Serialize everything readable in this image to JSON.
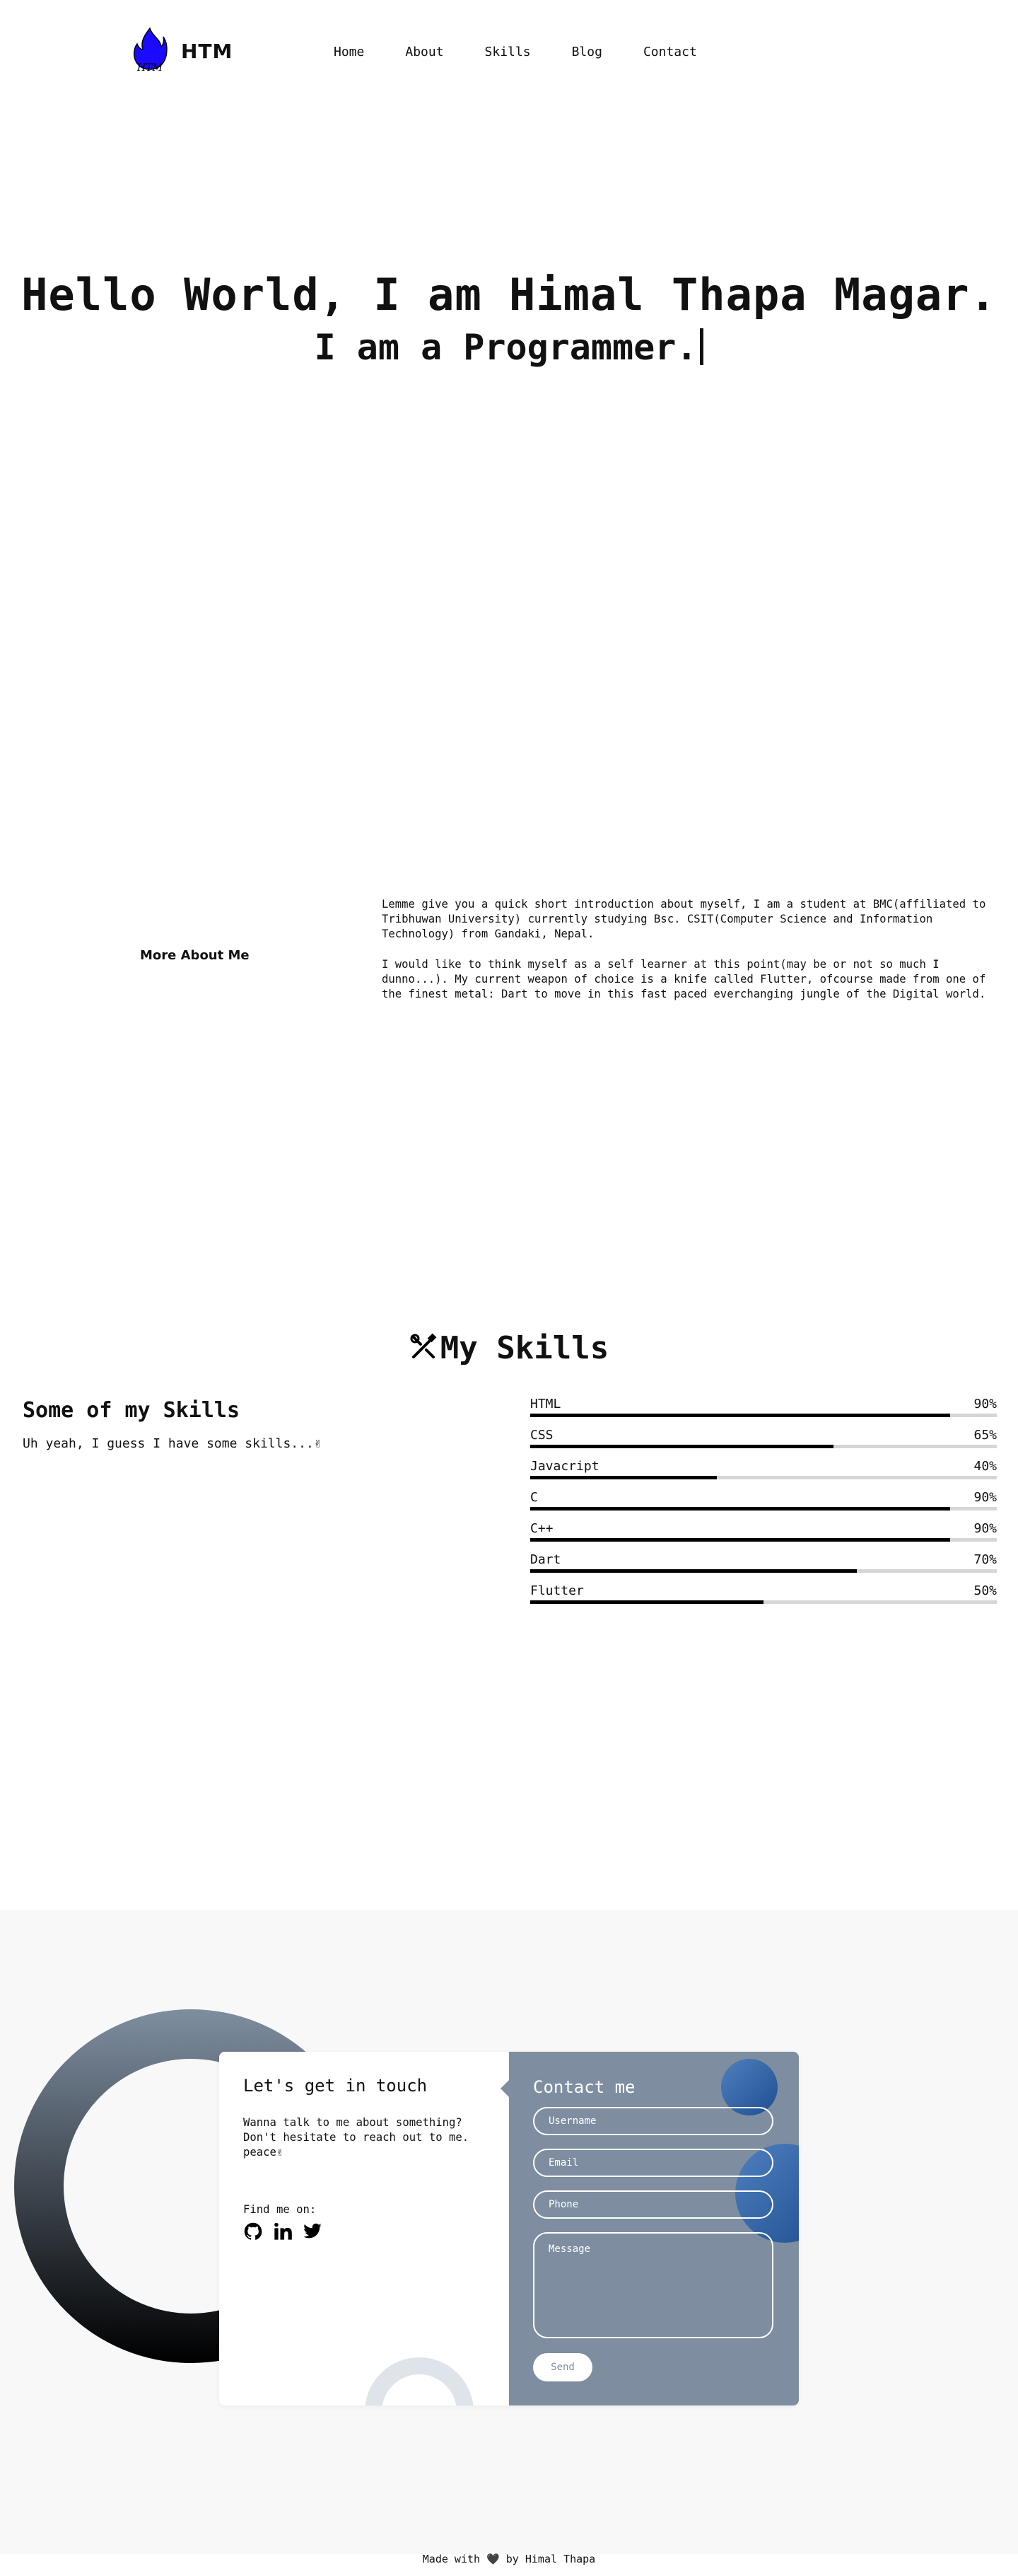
{
  "brand": {
    "name": "HTM",
    "logo_text": "HTM",
    "logo_color": "#1a0aff"
  },
  "nav": {
    "items": [
      "Home",
      "About",
      "Skills",
      "Blog",
      "Contact"
    ]
  },
  "hero": {
    "title": "Hello World, I am Himal Thapa Magar.",
    "subtitle": "I am a Programmer."
  },
  "about": {
    "link": "More About Me",
    "paragraphs": [
      "Lemme give you a quick short introduction about myself, I am a student at BMC(affiliated to Tribhuwan University) currently studying Bsc. CSIT(Computer Science and Information Technology) from Gandaki, Nepal.",
      "I would like to think myself as a self learner at this point(may be or not so much I dunno...). My current weapon of choice is a knife called Flutter, ofcourse made from one of the finest metal: Dart to move in this fast paced everchanging jungle of the Digital world."
    ]
  },
  "skills": {
    "title": "My Skills",
    "icon": "tools-icon",
    "left_title": "Some of my Skills",
    "left_sub": "Uh yeah, I guess I have some skills...✌",
    "items": [
      {
        "name": "HTML",
        "percent_label": "90%",
        "value": 90
      },
      {
        "name": "CSS",
        "percent_label": "65%",
        "value": 65
      },
      {
        "name": "Javacript",
        "percent_label": "40%",
        "value": 40
      },
      {
        "name": "C",
        "percent_label": "90%",
        "value": 90
      },
      {
        "name": "C++",
        "percent_label": "90%",
        "value": 90
      },
      {
        "name": "Dart",
        "percent_label": "70%",
        "value": 70
      },
      {
        "name": "Flutter",
        "percent_label": "50%",
        "value": 50
      }
    ]
  },
  "contact": {
    "heading": "Let's get in touch",
    "text": "Wanna talk to me about something? Don't hesitate to reach out to me. peace✌",
    "find_me": "Find me on:",
    "socials": [
      "github-icon",
      "linkedin-icon",
      "twitter-icon"
    ],
    "form_title": "Contact me",
    "username_placeholder": "Username",
    "email_placeholder": "Email",
    "phone_placeholder": "Phone",
    "message_placeholder": "Message",
    "send": "Send",
    "accent": "#7e8ea0"
  },
  "footer": {
    "text": "Made with 🖤 by Himal Thapa"
  }
}
